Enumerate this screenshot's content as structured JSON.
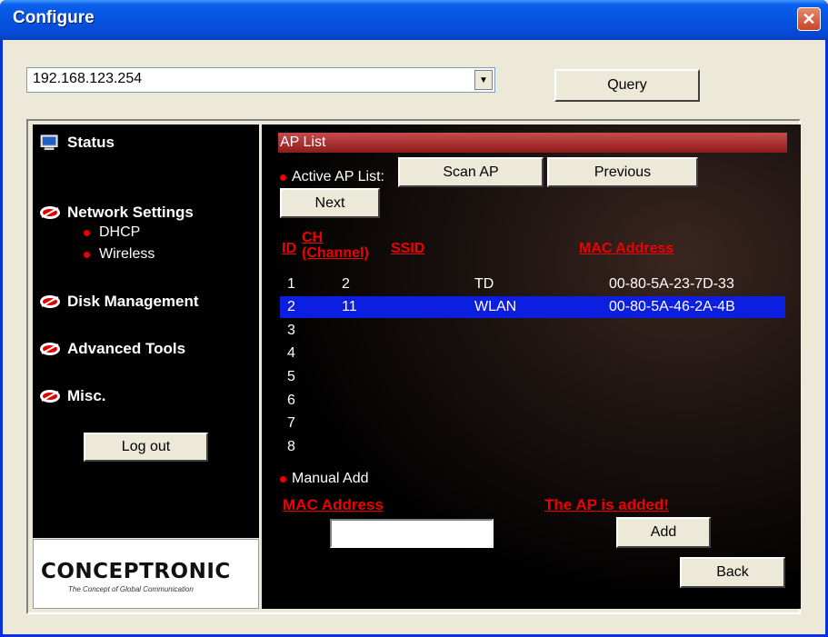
{
  "window": {
    "title": "Configure",
    "close": "✕"
  },
  "toolbar": {
    "ip_value": "192.168.123.254",
    "dropdown_arrow": "▼",
    "query_label": "Query"
  },
  "sidebar": {
    "status": "Status",
    "network_settings": "Network Settings",
    "dhcp": "DHCP",
    "wireless": "Wireless",
    "disk_management": "Disk Management",
    "advanced_tools": "Advanced Tools",
    "misc": "Misc.",
    "logout": "Log out",
    "logo": "CONCEPTRONIC",
    "logo_tagline": "The Concept of Global Communication",
    "icons": {
      "status": "monitor-icon",
      "nav": "red-eye-bullet-icon"
    }
  },
  "ap_list": {
    "header": "AP List",
    "active_label": "Active AP List:",
    "scan_label": "Scan AP",
    "previous_label": "Previous",
    "next_label": "Next",
    "columns": {
      "id": "ID",
      "ch": "CH",
      "ch_sub": "(Channel)",
      "ssid": "SSID",
      "mac": "MAC Address"
    },
    "rows": [
      {
        "id": "1",
        "ch": "2",
        "ssid": "TD",
        "mac": "00-80-5A-23-7D-33"
      },
      {
        "id": "2",
        "ch": "11",
        "ssid": "WLAN",
        "mac": "00-80-5A-46-2A-4B"
      },
      {
        "id": "3",
        "ch": "",
        "ssid": "",
        "mac": ""
      },
      {
        "id": "4",
        "ch": "",
        "ssid": "",
        "mac": ""
      },
      {
        "id": "5",
        "ch": "",
        "ssid": "",
        "mac": ""
      },
      {
        "id": "6",
        "ch": "",
        "ssid": "",
        "mac": ""
      },
      {
        "id": "7",
        "ch": "",
        "ssid": "",
        "mac": ""
      },
      {
        "id": "8",
        "ch": "",
        "ssid": "",
        "mac": ""
      }
    ],
    "selected_row": 2
  },
  "manual": {
    "label": "Manual Add",
    "mac_label": "MAC Address",
    "status": "The AP is added!",
    "mac_value": "",
    "add_label": "Add",
    "back_label": "Back"
  },
  "colors": {
    "accent_red": "#e00000",
    "selection": "#0c1fe0",
    "titlebar": "#0553e0"
  }
}
